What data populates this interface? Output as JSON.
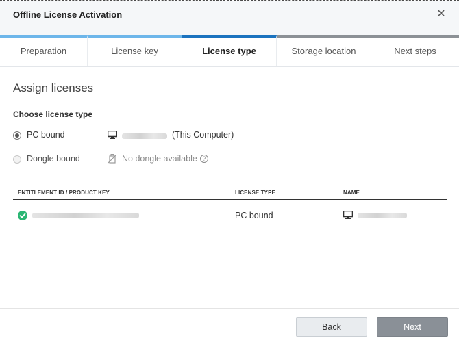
{
  "dialog": {
    "title": "Offline License Activation",
    "close_icon": "close-icon"
  },
  "steps": [
    {
      "label": "Preparation",
      "state": "done"
    },
    {
      "label": "License key",
      "state": "done"
    },
    {
      "label": "License type",
      "state": "active"
    },
    {
      "label": "Storage location",
      "state": "pending"
    },
    {
      "label": "Next steps",
      "state": "pending"
    }
  ],
  "main": {
    "heading": "Assign licenses",
    "choose_label": "Choose license type",
    "options": {
      "pc_bound": {
        "label": "PC bound",
        "selected": true,
        "detail_suffix": "(This Computer)",
        "icon": "computer-icon"
      },
      "dongle_bound": {
        "label": "Dongle bound",
        "selected": false,
        "detail": "No dongle available",
        "icon": "no-dongle-icon",
        "help_icon": "help-icon"
      }
    }
  },
  "table": {
    "columns": [
      "ENTITLEMENT ID / PRODUCT KEY",
      "LICENSE TYPE",
      "NAME"
    ],
    "rows": [
      {
        "status_icon": "check-circle-icon",
        "license_type": "PC bound",
        "name_icon": "computer-icon"
      }
    ]
  },
  "footer": {
    "back_label": "Back",
    "next_label": "Next"
  },
  "colors": {
    "step_done": "#6db6ea",
    "step_active": "#1b73bf",
    "step_pending": "#8c9196",
    "success": "#2bb673",
    "next_button": "#8a9097"
  }
}
